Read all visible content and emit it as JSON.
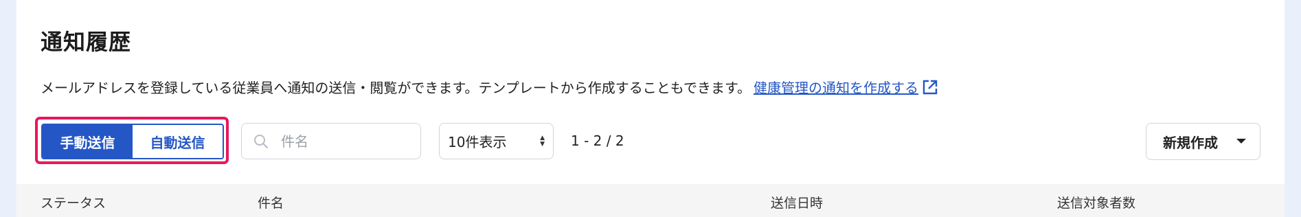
{
  "page": {
    "title": "通知履歴",
    "description": "メールアドレスを登録している従業員へ通知の送信・閲覧ができます。テンプレートから作成することもできます。",
    "description_link": "健康管理の通知を作成する"
  },
  "toolbar": {
    "tabs": [
      {
        "label": "手動送信",
        "active": true
      },
      {
        "label": "自動送信",
        "active": false
      }
    ],
    "search_placeholder": "件名",
    "per_page_label": "10件表示",
    "pagination": "1 - 2 / 2",
    "new_button_label": "新規作成"
  },
  "table": {
    "columns": [
      "ステータス",
      "件名",
      "送信日時",
      "送信対象者数"
    ]
  },
  "colors": {
    "accent": "#2457c5",
    "highlight": "#e8175d",
    "background": "#eaf0fb"
  }
}
